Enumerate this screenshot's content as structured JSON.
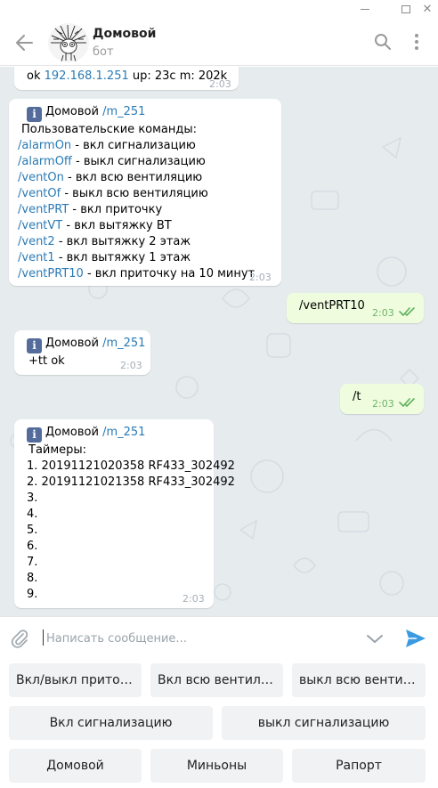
{
  "chat": {
    "title": "Домовой",
    "subtitle": "бот"
  },
  "messages": [
    {
      "lines": [
        {
          "link": "",
          "text": "ok "
        },
        {
          "link": "192.168.1.251",
          "text": " up: 23c m: 202k"
        }
      ],
      "time": "2:03"
    },
    {
      "sender": "Домовой",
      "sender_link": "/m_251",
      "intro": "Пользовательские команды:",
      "commands": [
        {
          "cmd": "/alarmOn",
          "desc": " - вкл сигнализацию"
        },
        {
          "cmd": "/alarmOff",
          "desc": " - выкл сигнализацию"
        },
        {
          "cmd": "/ventOn",
          "desc": " - вкл всю вентиляцию"
        },
        {
          "cmd": "/ventOf",
          "desc": " - выкл всю вентиляцию"
        },
        {
          "cmd": "/ventPRT",
          "desc": " - вкл приточку"
        },
        {
          "cmd": "/ventVT",
          "desc": " - вкл вытяжку ВТ"
        },
        {
          "cmd": "/vent2",
          "desc": " - вкл вытяжку 2 этаж"
        },
        {
          "cmd": "/vent1",
          "desc": " - вкл вытяжку 1 этаж"
        },
        {
          "cmd": "/ventPRT10",
          "desc": " - вкл приточку на 10 минут"
        }
      ],
      "time": "2:03"
    },
    {
      "text": "/ventPRT10",
      "time": "2:03",
      "outgoing": true
    },
    {
      "sender": "Домовой",
      "sender_link": "/m_251",
      "text": "+tt ok",
      "time": "2:03"
    },
    {
      "text": "/t",
      "time": "2:03",
      "outgoing": true
    },
    {
      "sender": "Домовой",
      "sender_link": "/m_251",
      "intro": "Таймеры:",
      "items": [
        "1. 20191121020358 RF433_302492",
        "2. 20191121021358 RF433_302492",
        "3.",
        "4.",
        "5.",
        "6.",
        "7.",
        "8.",
        "9."
      ],
      "time": "2:03"
    }
  ],
  "composer": {
    "placeholder": "Написать сообщение..."
  },
  "keyboard": {
    "rows": [
      [
        "Вкл/выкл приточку",
        "Вкл всю вентиляцию",
        "выкл всю вентиляцию"
      ],
      [
        "Вкл сигнализацию",
        "выкл сигнализацию"
      ],
      [
        "Домовой",
        "Миньоны",
        "Рапорт"
      ]
    ]
  },
  "icons": {
    "back": "arrow-left-icon",
    "search": "search-icon",
    "more": "more-vertical-icon",
    "attach": "paperclip-icon",
    "keyboard_toggle": "chevron-down-icon",
    "send": "send-icon",
    "info": "info-icon",
    "read": "double-check-icon"
  },
  "colors": {
    "accent": "#2a7ab5",
    "outgoing_bubble": "#effdde",
    "chat_background": "#e6ebee",
    "info_badge": "#536c9b",
    "read_ticks": "#5fb15f",
    "send_icon": "#3a9be3"
  }
}
